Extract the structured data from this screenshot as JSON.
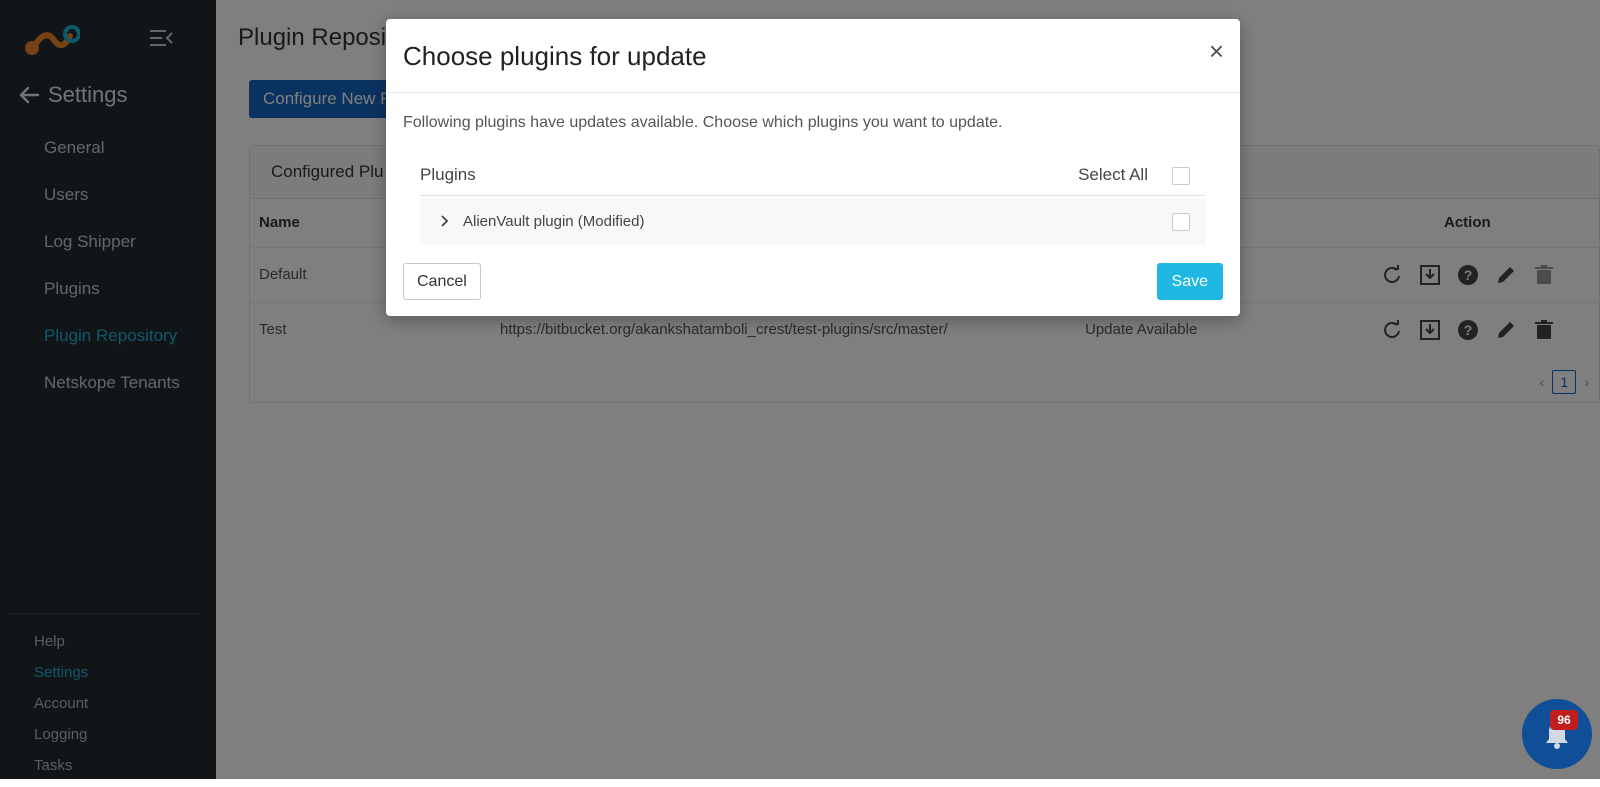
{
  "sidebar": {
    "back_title": "Settings",
    "nav": [
      {
        "label": "General",
        "active": false
      },
      {
        "label": "Users",
        "active": false
      },
      {
        "label": "Log Shipper",
        "active": false
      },
      {
        "label": "Plugins",
        "active": false
      },
      {
        "label": "Plugin Repository",
        "active": true
      },
      {
        "label": "Netskope Tenants",
        "active": false
      }
    ],
    "footer": [
      {
        "label": "Help",
        "active": false
      },
      {
        "label": "Settings",
        "active": true
      },
      {
        "label": "Account",
        "active": false
      },
      {
        "label": "Logging",
        "active": false
      },
      {
        "label": "Tasks",
        "active": false
      }
    ]
  },
  "main": {
    "page_title": "Plugin Reposi",
    "configure_button": "Configure New R",
    "card_title": "Configured Plu",
    "table": {
      "headers": {
        "name": "Name",
        "action": "Action"
      },
      "rows": [
        {
          "name": "Default",
          "url": "",
          "status": ""
        },
        {
          "name": "Test",
          "url": "https://bitbucket.org/akankshatamboli_crest/test-plugins/src/master/",
          "status": "Update Available"
        }
      ]
    },
    "pagination": {
      "current_page": "1"
    }
  },
  "modal": {
    "title": "Choose plugins for update",
    "close_label": "×",
    "description": "Following plugins have updates available. Choose which plugins you want to update.",
    "list_header": "Plugins",
    "select_all_label": "Select All",
    "plugins": [
      {
        "name": "AlienVault plugin (Modified)",
        "checked": false
      }
    ],
    "cancel_label": "Cancel",
    "save_label": "Save"
  },
  "notifications": {
    "count": "96"
  },
  "colors": {
    "sidebar_bg": "#252a31",
    "accent": "#1fb0d8",
    "primary_button": "#1565c0",
    "save_button": "#1fb8e3",
    "badge": "#c11d1d"
  }
}
